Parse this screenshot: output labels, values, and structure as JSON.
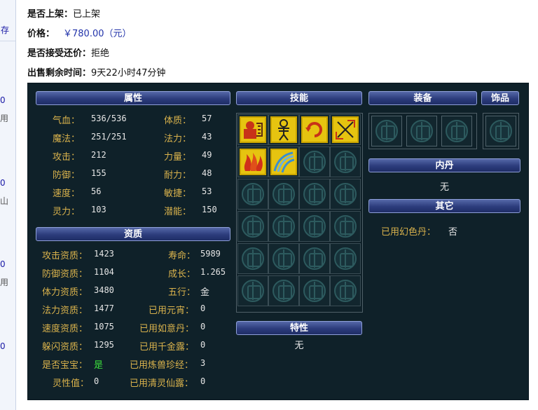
{
  "sidebar_fragments": [
    "存",
    "0",
    "用",
    "0",
    "山",
    "0",
    "用",
    "0"
  ],
  "listing": {
    "on_shelf_label": "是否上架：",
    "on_shelf_value": "已上架",
    "price_label": "价格：",
    "price_value": "￥780.00（元）",
    "bargain_label": "是否接受还价：",
    "bargain_value": "拒绝",
    "time_label": "出售剩余时间：",
    "time_value": "9天22小时47分钟"
  },
  "attributes": {
    "header": "属性",
    "left": [
      {
        "label": "气血：",
        "value": "536/536"
      },
      {
        "label": "魔法：",
        "value": "251/251"
      },
      {
        "label": "攻击：",
        "value": "212"
      },
      {
        "label": "防御：",
        "value": "155"
      },
      {
        "label": "速度：",
        "value": "56"
      },
      {
        "label": "灵力：",
        "value": "103"
      }
    ],
    "right": [
      {
        "label": "体质：",
        "value": "57"
      },
      {
        "label": "法力：",
        "value": "43"
      },
      {
        "label": "力量：",
        "value": "49"
      },
      {
        "label": "耐力：",
        "value": "48"
      },
      {
        "label": "敏捷：",
        "value": "53"
      },
      {
        "label": "潜能：",
        "value": "150"
      }
    ]
  },
  "aptitude": {
    "header": "资质",
    "left": [
      {
        "label": "攻击资质：",
        "value": "1423"
      },
      {
        "label": "防御资质：",
        "value": "1104"
      },
      {
        "label": "体力资质：",
        "value": "3480"
      },
      {
        "label": "法力资质：",
        "value": "1477"
      },
      {
        "label": "速度资质：",
        "value": "1075"
      },
      {
        "label": "躲闪资质：",
        "value": "1295"
      },
      {
        "label": "是否宝宝：",
        "value": "是"
      },
      {
        "label": "灵性值：",
        "value": "0"
      }
    ],
    "right": [
      {
        "label": "寿命：",
        "value": "5989"
      },
      {
        "label": "成长：",
        "value": "1.265"
      },
      {
        "label": "五行：",
        "value": "金"
      },
      {
        "label": "已用元宵：",
        "value": "0"
      },
      {
        "label": "已用如意丹：",
        "value": "0"
      },
      {
        "label": "已用千金露：",
        "value": "0"
      },
      {
        "label": "已用炼兽珍经：",
        "value": "3"
      },
      {
        "label": "已用清灵仙露：",
        "value": "0"
      }
    ]
  },
  "skills": {
    "header": "技能",
    "icons": [
      "skill-1-icon",
      "skill-2-icon",
      "skill-3-icon",
      "skill-4-icon",
      "skill-5-icon",
      "skill-6-icon"
    ]
  },
  "traits": {
    "header": "特性",
    "value": "无"
  },
  "equipment": {
    "header": "装备"
  },
  "accessory": {
    "header": "饰品"
  },
  "neidan": {
    "header": "内丹",
    "value": "无"
  },
  "other": {
    "header": "其它",
    "label": "已用幻色丹：",
    "value": "否"
  },
  "colors": {
    "panel_bg": "#0f2129",
    "label_gold": "#d9b24c",
    "value_white": "#e6e6e6",
    "highlight_green": "#3ce03c",
    "header_blue": "#2c3c7c"
  }
}
